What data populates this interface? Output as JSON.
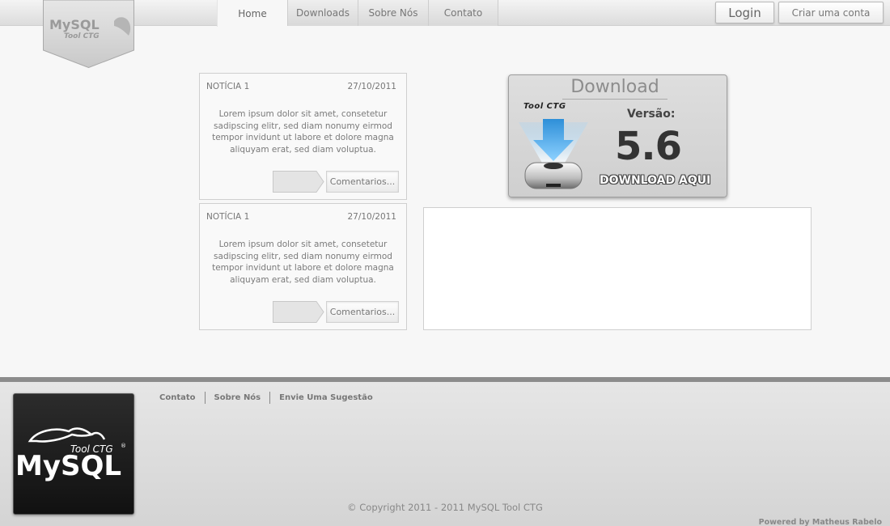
{
  "header": {
    "logo": {
      "line1": "MySQL",
      "line2": "Tool CTG"
    },
    "nav": [
      {
        "label": "Home",
        "active": true
      },
      {
        "label": "Downloads",
        "active": false
      },
      {
        "label": "Sobre Nós",
        "active": false
      },
      {
        "label": "Contato",
        "active": false
      }
    ],
    "login_label": "Login",
    "signup_label": "Criar uma conta"
  },
  "news": [
    {
      "title": "NOTÍCIA 1",
      "date": "27/10/2011",
      "body": "Lorem ipsum dolor sit amet, consetetur sadipscing elitr, sed diam nonumy eirmod tempor invidunt ut labore et dolore magna aliquyam erat, sed diam voluptua.",
      "comments_label": "Comentarios..."
    },
    {
      "title": "NOTÍCIA 1",
      "date": "27/10/2011",
      "body": "Lorem ipsum dolor sit amet, consetetur sadipscing elitr, sed diam nonumy eirmod tempor invidunt ut labore et dolore magna aliquyam erat, sed diam voluptua.",
      "comments_label": "Comentarios..."
    }
  ],
  "download": {
    "title": "Download",
    "small_logo": "Tool CTG",
    "version_label": "Versão:",
    "version": "5.6",
    "cta": "DOWNLOAD AQUI"
  },
  "footer": {
    "links": [
      "Contato",
      "Sobre Nós",
      "Envie Uma Sugestão"
    ],
    "logo": {
      "tagline": "Tool CTG",
      "registered": "®",
      "wordmark": "MySQL"
    },
    "copyright": "© Copyright 2011 - 2011 MySQL Tool CTG",
    "powered": "Powered by Matheus Rabelo"
  },
  "colors": {
    "background": "#f7f7f7",
    "footer_border": "#8c8c8c",
    "download_arrow": "#4aa3e0"
  }
}
